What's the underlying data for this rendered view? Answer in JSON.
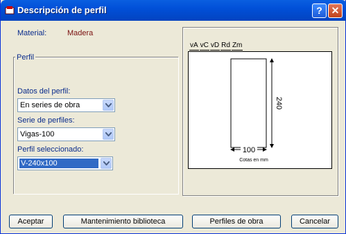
{
  "window": {
    "title": "Descripción de perfil"
  },
  "material": {
    "label": "Material:",
    "value": "Madera"
  },
  "perfil": {
    "frame_title": "Perfil",
    "datos_label": "Datos del perfil:",
    "datos_value": "En series de obra",
    "serie_label": "Serie de perfiles:",
    "serie_value": "Vigas-100",
    "perfil_sel_label": "Perfil seleccionado:",
    "perfil_sel_value": "V-240x100"
  },
  "drawing": {
    "tabs": [
      "vA",
      "vC",
      "vD",
      "Rd",
      "Zm"
    ],
    "height_dim": "240",
    "width_dim": "100",
    "units_caption": "Cotas en mm"
  },
  "buttons": {
    "accept": "Aceptar",
    "library": "Mantenimiento biblioteca",
    "profiles": "Perfiles de obra",
    "cancel": "Cancelar"
  },
  "colors": {
    "title_bar": "#0150d8",
    "label_blue": "#0a2c8c",
    "value_maroon": "#7a1010",
    "selection": "#316ac5"
  }
}
